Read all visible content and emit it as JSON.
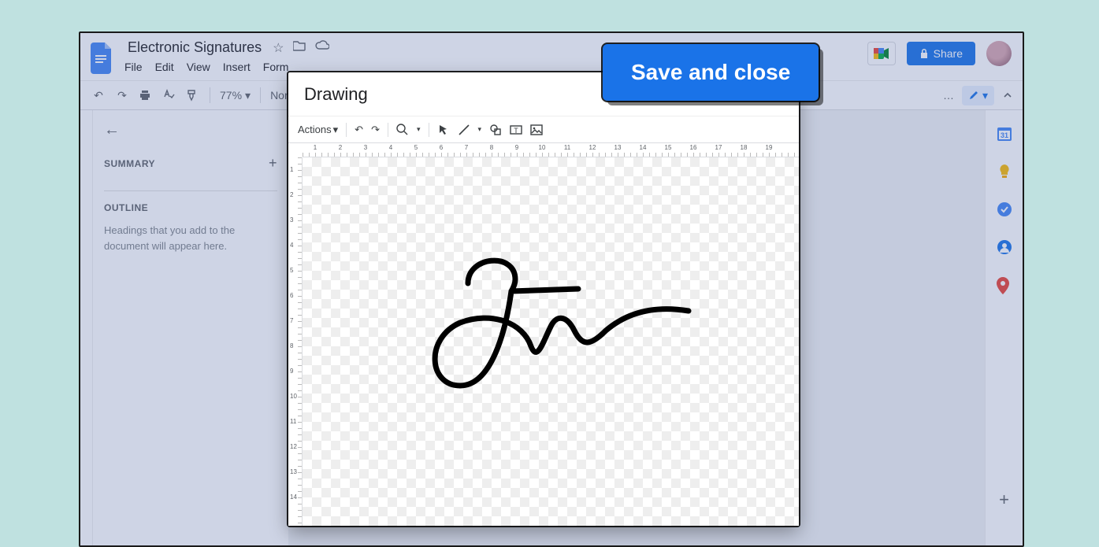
{
  "doc": {
    "title": "Electronic Signatures",
    "menus": [
      "File",
      "Edit",
      "View",
      "Insert",
      "Form"
    ],
    "share_label": "Share"
  },
  "toolbar": {
    "zoom": "77%",
    "style_label": "Nor",
    "more": "…"
  },
  "sidebar": {
    "summary_label": "SUMMARY",
    "outline_label": "OUTLINE",
    "outline_empty": "Headings that you add to the document will appear here."
  },
  "drawing": {
    "title": "Drawing",
    "actions_label": "Actions",
    "hruler_max": 19,
    "vruler_max": 14
  },
  "callout": {
    "save_close": "Save and close"
  }
}
